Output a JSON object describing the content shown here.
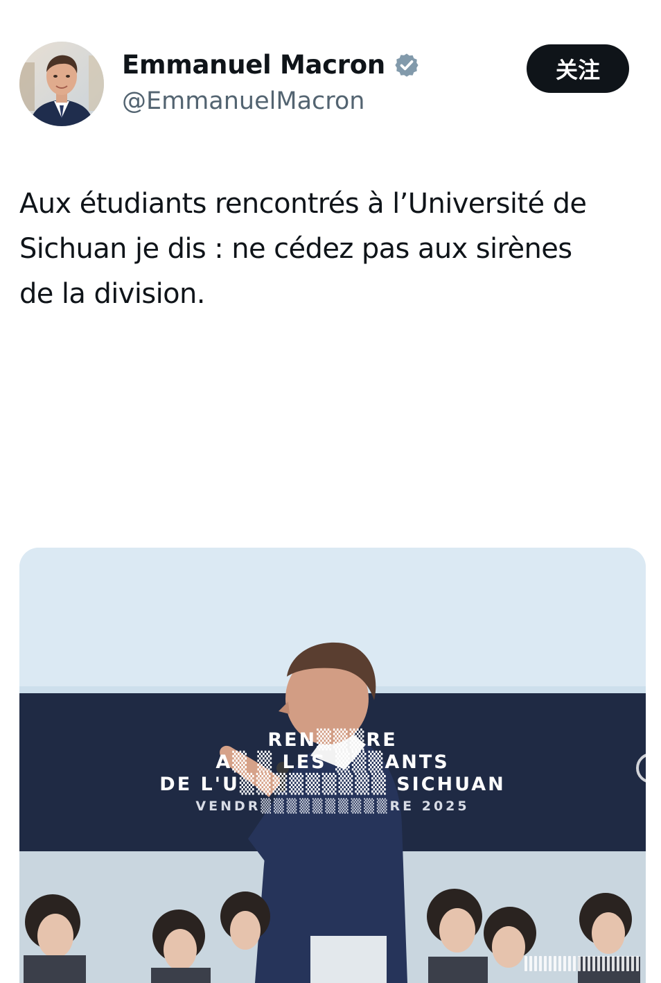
{
  "author": {
    "display_name": "Emmanuel Macron",
    "handle": "@EmmanuelMacron",
    "verified": true
  },
  "follow_button": {
    "label": "关注"
  },
  "tweet": {
    "lines": [
      "Aux étudiants rencontrés à l’Université de",
      "Sichuan je dis : ne cédez pas aux sirènes",
      "de la division."
    ]
  },
  "media": {
    "banner_lines": [
      "REN▒▒▒RE",
      "A▒ ▒ LES ▒▒▒ANTS",
      "DE L'U▒▒▒▒▒▒▒▒▒ SICHUAN",
      "VENDR▒▒▒▒▒▒▒▒▒▒RE 2025"
    ]
  },
  "colors": {
    "text_primary": "#0f1419",
    "text_secondary": "#536471",
    "verified_badge": "#829aab",
    "follow_bg": "#0f1419",
    "banner_bg": "#1f2a44"
  },
  "icons": {
    "verified": "verified-badge-icon",
    "watermark": "watermark-icon"
  }
}
